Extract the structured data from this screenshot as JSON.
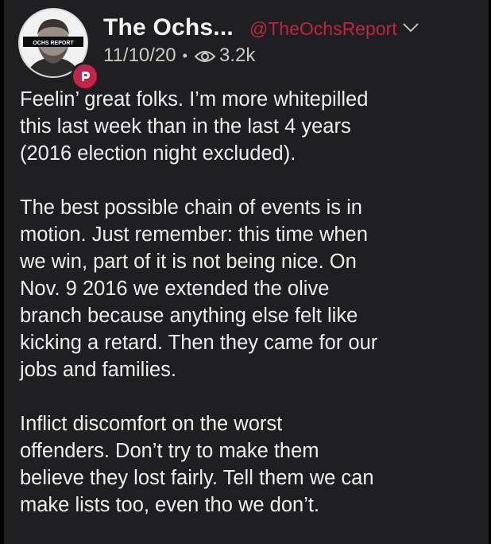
{
  "post": {
    "author": {
      "display_name": "The Ochs...",
      "handle": "@TheOchsReport",
      "avatar_text": "OCHS REPORT",
      "badge_icon": "parler-logo-icon"
    },
    "date": "11/10/20",
    "separator": "•",
    "views": "3.2k",
    "paragraphs": [
      {
        "lines": [
          "Feelin’ great folks. I’m more whitepilled",
          "this last week than in the last 4 years",
          "(2016 election night excluded)."
        ]
      },
      {
        "lines": [
          "The best possible chain of events is in",
          "motion. Just remember: this time when",
          "we win, part of it is not being nice. On",
          "Nov. 9 2016 we extended the olive",
          "branch because anything else felt like",
          "kicking a retard. Then they came for our",
          "jobs and families."
        ]
      },
      {
        "lines": [
          "Inflict discomfort on the worst",
          "offenders. Don’t try to make them",
          "believe they lost fairly. Tell them we can",
          "make lists too, even tho we don’t."
        ]
      }
    ]
  },
  "colors": {
    "background": "#1f1f21",
    "text": "#eeeeee",
    "handle": "#c0243f",
    "badge": "#c3244a"
  }
}
